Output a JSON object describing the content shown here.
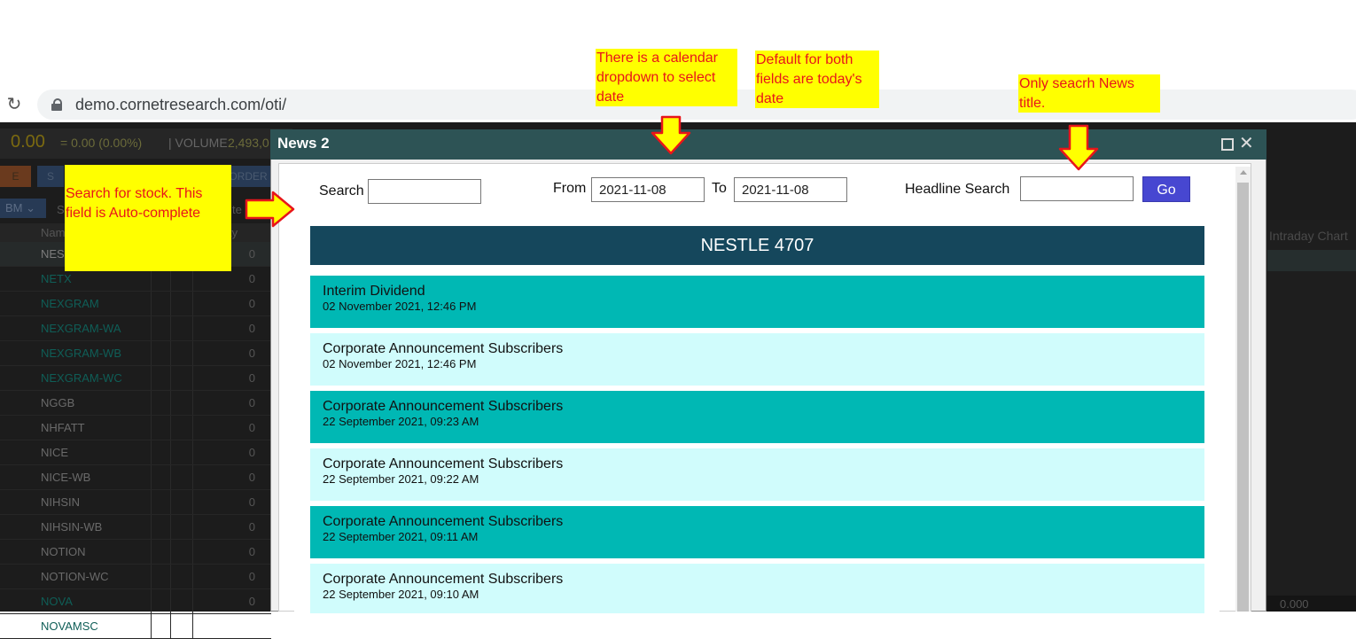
{
  "browser": {
    "url": "demo.cornetresearch.com/oti/"
  },
  "app": {
    "price": "0.00",
    "change": "= 0.00 (0.00%)",
    "volume_label": "| VOLUME",
    "volume_value": "2,493,0",
    "tabs": [
      "E",
      "S",
      "ORDER"
    ],
    "board_select": "BM ⌄",
    "table_header": {
      "name": "Nam",
      "qty": "ty",
      "col_s": "S",
      "col_te": "te"
    },
    "stocks": [
      {
        "name": "NES",
        "qty": "0",
        "color": "#7c7c7c"
      },
      {
        "name": "NETX",
        "qty": "0",
        "color": "#0f5e57"
      },
      {
        "name": "NEXGRAM",
        "qty": "0",
        "color": "#0f5e57"
      },
      {
        "name": "NEXGRAM-WA",
        "qty": "0",
        "color": "#0f5e57"
      },
      {
        "name": "NEXGRAM-WB",
        "qty": "0",
        "color": "#0f5e57"
      },
      {
        "name": "NEXGRAM-WC",
        "qty": "0",
        "color": "#0f5e57"
      },
      {
        "name": "NGGB",
        "qty": "0",
        "color": "#6a6a6a"
      },
      {
        "name": "NHFATT",
        "qty": "0",
        "color": "#6a6a6a"
      },
      {
        "name": "NICE",
        "qty": "0",
        "color": "#6a6a6a"
      },
      {
        "name": "NICE-WB",
        "qty": "0",
        "color": "#6a6a6a"
      },
      {
        "name": "NIHSIN",
        "qty": "0",
        "color": "#6a6a6a"
      },
      {
        "name": "NIHSIN-WB",
        "qty": "0",
        "color": "#6a6a6a"
      },
      {
        "name": "NOTION",
        "qty": "0",
        "color": "#6a6a6a"
      },
      {
        "name": "NOTION-WC",
        "qty": "0",
        "color": "#6a6a6a"
      },
      {
        "name": "NOVA",
        "qty": "0",
        "color": "#0f5e57"
      },
      {
        "name": "NOVAMSC",
        "qty": "",
        "color": "#0f5e57"
      }
    ],
    "right_panel_title": "Intraday Chart",
    "right_panel_value": "0.000"
  },
  "modal": {
    "title": "News 2",
    "search_label": "Search",
    "search_value": "",
    "from_label": "From",
    "from_value": "2021-11-08",
    "to_label": "To",
    "to_value": "2021-11-08",
    "headline_label": "Headline Search",
    "headline_value": "",
    "go_label": "Go",
    "stock_header": "NESTLE 4707",
    "news": [
      {
        "title": "Interim Dividend",
        "date": "02 November 2021, 12:46 PM"
      },
      {
        "title": "Corporate Announcement Subscribers",
        "date": "02 November 2021, 12:46 PM"
      },
      {
        "title": "Corporate Announcement Subscribers",
        "date": "22 September 2021, 09:23 AM"
      },
      {
        "title": "Corporate Announcement Subscribers",
        "date": "22 September 2021, 09:22 AM"
      },
      {
        "title": "Corporate Announcement Subscribers",
        "date": "22 September 2021, 09:11 AM"
      },
      {
        "title": "Corporate Announcement Subscribers",
        "date": "22 September 2021, 09:10 AM"
      }
    ]
  },
  "annotations": {
    "calendar": "There is a calendar dropdown to select date",
    "default_date": "Default for both fields are today's date",
    "headline": "Only seacrh News title.",
    "stock_search": "Search for stock. This field is Auto-complete"
  },
  "colors": {
    "news_dark": "#00b8b4",
    "news_light": "#d0fcfc",
    "header": "#15475c",
    "go": "#4747d1",
    "note_bg": "#ffff00",
    "note_text": "#e8151a"
  }
}
